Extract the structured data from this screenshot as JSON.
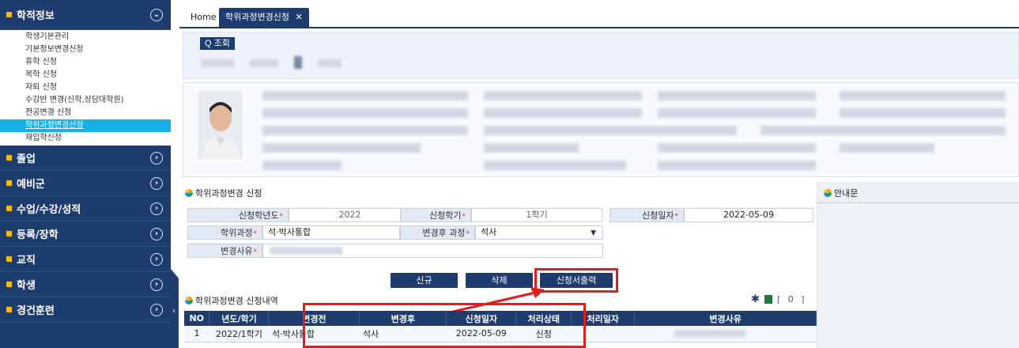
{
  "sidebar": {
    "menus": [
      {
        "label": "학적정보",
        "expanded": true,
        "chev": "⌄"
      },
      {
        "label": "졸업",
        "chev": "›"
      },
      {
        "label": "예비군",
        "chev": "›"
      },
      {
        "label": "수업/수강/성적",
        "chev": "›"
      },
      {
        "label": "등록/장학",
        "chev": "›"
      },
      {
        "label": "교직",
        "chev": "›"
      },
      {
        "label": "학생",
        "chev": "›"
      },
      {
        "label": "경건훈련",
        "chev": "›"
      }
    ],
    "sub_items": [
      "학생기본관리",
      "기본정보변경신청",
      "휴학 신청",
      "복학 신청",
      "자퇴 신청",
      "수강반 변경(신학,상담대학원)",
      "전공변경 신청",
      "학위과정변경신청",
      "재입학신청"
    ],
    "active_sub": 7,
    "collapse_glyph": "‹"
  },
  "tabs": {
    "home": "Home",
    "current": "학위과정변경신청",
    "close_glyph": "✕"
  },
  "search": {
    "button_label": "Q 조회"
  },
  "form": {
    "section_title": "학위과정변경 신청",
    "year_label": "신청학년도",
    "year_value": "2022",
    "term_label": "신청학기",
    "term_value": "1학기",
    "date_label": "신청일자",
    "date_value": "2022-05-09",
    "degree_label": "학위과정",
    "degree_value": "석·박사통합",
    "after_label": "변경후 과정",
    "after_value": "석사",
    "reason_label": "변경사유",
    "required_mark": "*",
    "dropdown_glyph": "▼"
  },
  "guide": {
    "title": "안내문"
  },
  "buttons": {
    "new": "신규",
    "delete": "삭제",
    "print": "신청서출력"
  },
  "history": {
    "title": "학위과정변경 신청내역",
    "counter": "[ 0 ]",
    "columns": [
      "NO",
      "년도/학기",
      "변경전",
      "변경후",
      "신청일자",
      "처리상태",
      "처리일자",
      "변경사유"
    ],
    "rows": [
      [
        "1",
        "2022/1학기",
        "석·박사통합",
        "석사",
        "2022-05-09",
        "신청",
        "",
        ""
      ]
    ]
  },
  "colors": {
    "navy": "#1e3c6e",
    "accent_blue": "#14b0e6",
    "highlight_red": "#e51c1c",
    "menu_square": "#f4b920"
  }
}
